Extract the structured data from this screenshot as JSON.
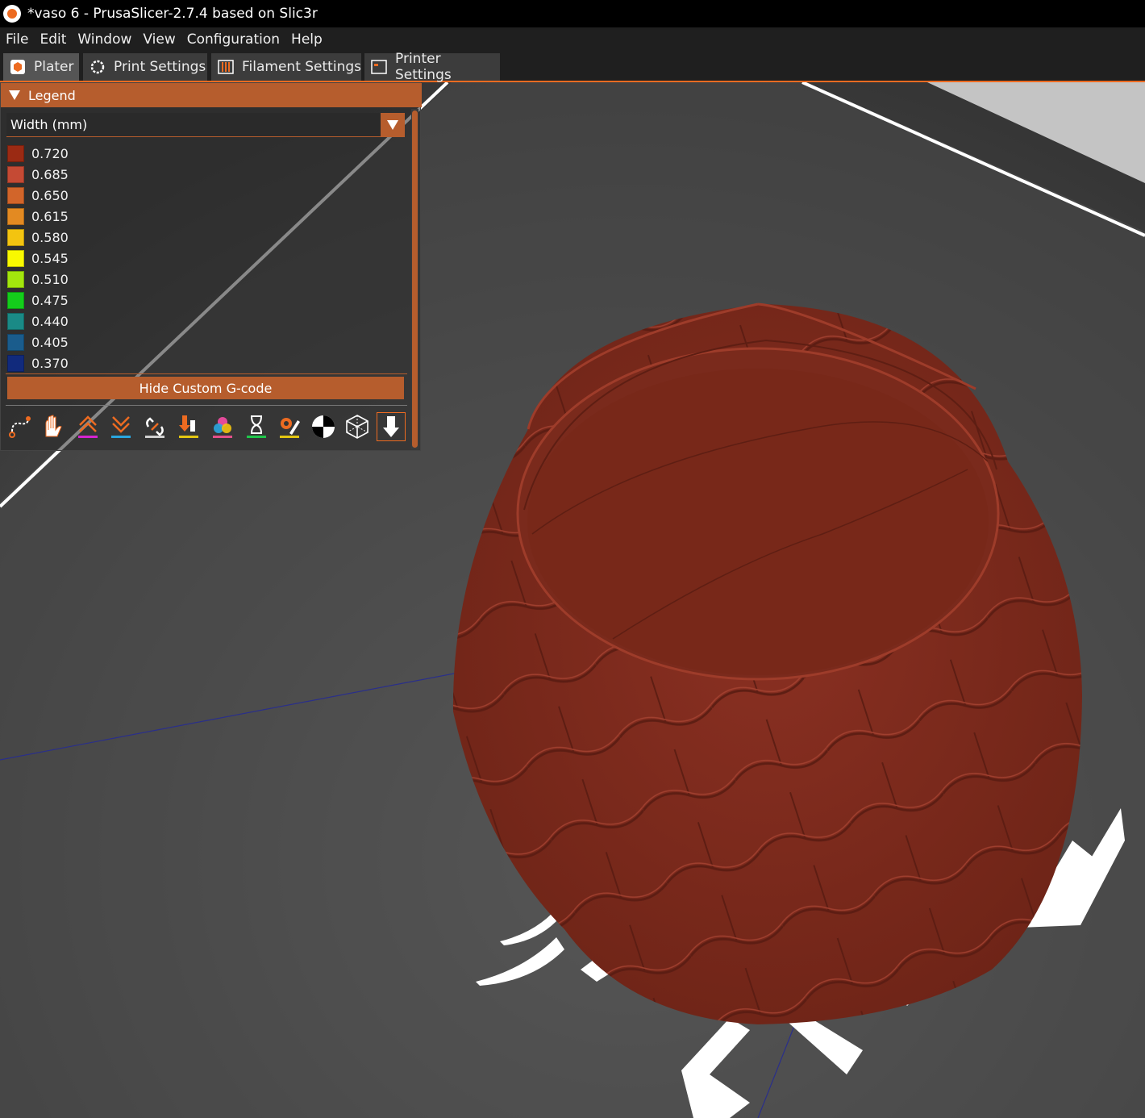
{
  "window": {
    "title": "*vaso 6 - PrusaSlicer-2.7.4 based on Slic3r"
  },
  "menu": [
    "File",
    "Edit",
    "Window",
    "View",
    "Configuration",
    "Help"
  ],
  "tabs": [
    {
      "label": "Plater",
      "icon": "plater-icon",
      "active": true
    },
    {
      "label": "Print Settings",
      "icon": "print-settings-icon"
    },
    {
      "label": "Filament Settings",
      "icon": "filament-icon"
    },
    {
      "label": "Printer Settings",
      "icon": "printer-icon"
    }
  ],
  "legend": {
    "title": "Legend",
    "view_type": "Width (mm)",
    "entries": [
      {
        "value": "0.720",
        "color": "#9b2a13"
      },
      {
        "value": "0.685",
        "color": "#c54a34"
      },
      {
        "value": "0.650",
        "color": "#d2652a"
      },
      {
        "value": "0.615",
        "color": "#e38a22"
      },
      {
        "value": "0.580",
        "color": "#f3c410"
      },
      {
        "value": "0.545",
        "color": "#f9f900"
      },
      {
        "value": "0.510",
        "color": "#a3e60d"
      },
      {
        "value": "0.475",
        "color": "#14cd1b"
      },
      {
        "value": "0.440",
        "color": "#1a8a86"
      },
      {
        "value": "0.405",
        "color": "#1a5c8c"
      },
      {
        "value": "0.370",
        "color": "#112a7c"
      }
    ],
    "button": "Hide Custom G-code",
    "option_icons": [
      "travel-icon",
      "wipe-icon",
      "retractions-icon",
      "deretractions-icon",
      "seams-icon",
      "tool-changes-icon",
      "color-changes-icon",
      "pause-icon",
      "custom-gcode-icon",
      "center-of-gravity-icon",
      "shells-icon",
      "tool-marker-icon"
    ]
  },
  "colors": {
    "accent": "#ed6b21",
    "legend_header": "#b65d2d",
    "model": "#7e2a1c"
  }
}
